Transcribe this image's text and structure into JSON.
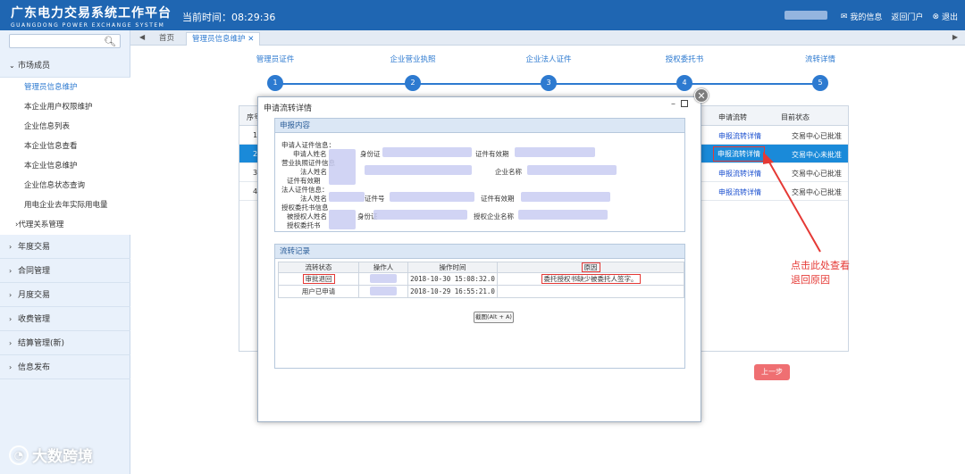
{
  "header": {
    "title_cn": "广东电力交易系统工作平台",
    "title_en": "GUANGDONG POWER EXCHANGE SYSTEM",
    "clock": "当前时间：08:29:36",
    "links": [
      "我的信息",
      "返回门户",
      "退出"
    ]
  },
  "sidebar": {
    "search_placeholder": "",
    "group_market": "市场成员",
    "items": [
      "管理员信息维护",
      "本企业用户权限维护",
      "企业信息列表",
      "本企业信息查看",
      "本企业信息维护",
      "企业信息状态查询",
      "用电企业去年实际用电量"
    ],
    "agent_group": "代理关系管理",
    "groups": [
      "年度交易",
      "合同管理",
      "月度交易",
      "收费管理",
      "结算管理(新)",
      "信息发布"
    ]
  },
  "tabs": {
    "home": "首页",
    "active": "管理员信息维护"
  },
  "steps": [
    {
      "label": "管理员证件",
      "num": "1"
    },
    {
      "label": "企业营业执照",
      "num": "2"
    },
    {
      "label": "企业法人证件",
      "num": "3"
    },
    {
      "label": "授权委托书",
      "num": "4"
    },
    {
      "label": "流转详情",
      "num": "5"
    }
  ],
  "bg_table": {
    "col_index": "序号",
    "col_flow": "申请流转",
    "col_status": "目前状态",
    "rows": [
      {
        "idx": "1",
        "flow": "申报流转详情",
        "status": "交易中心已批准"
      },
      {
        "idx": "2",
        "flow": "申报流转详情",
        "status": "交易中心未批准"
      },
      {
        "idx": "3",
        "flow": "申报流转详情",
        "status": "交易中心已批准"
      },
      {
        "idx": "4",
        "flow": "申报流转详情",
        "status": "交易中心已批准"
      }
    ]
  },
  "prev_button": "上一步",
  "annotation": [
    "点击此处查看",
    "退回原因"
  ],
  "dialog": {
    "title": "申请流转详情",
    "section1": "申报内容",
    "fields": {
      "applicant_cert": "申请人证件信息：",
      "applicant_name": "申请人姓名",
      "id_card": "身份证",
      "cert_valid": "证件有效期",
      "license": "营业执照证件信息",
      "legal_name": "法人姓名",
      "company_name": "企业名称",
      "license_valid": "证件有效期",
      "legal_cert": "法人证件信息：",
      "legal_name2": "法人姓名",
      "cert_no": "证件号",
      "legal_valid": "证件有效期",
      "proxy_cert": "授权委托书信息",
      "proxy_name": "被授权人姓名",
      "proxy_id": "身份证",
      "proxy_company": "授权企业名称",
      "proxy_doc": "授权委托书"
    },
    "section2": "流转记录",
    "flow_table": {
      "headers": [
        "流转状态",
        "操作人",
        "操作时间",
        "原因"
      ],
      "rows": [
        {
          "state": "审批退回",
          "time": "2018-10-30 15:08:32.0",
          "reason": "委托授权书缺少被委托人签字。"
        },
        {
          "state": "用户已申请",
          "time": "2018-10-29 16:55:21.0",
          "reason": ""
        }
      ]
    },
    "screenshot_button": "截图(Alt + A)"
  },
  "watermark": "大数跨境"
}
